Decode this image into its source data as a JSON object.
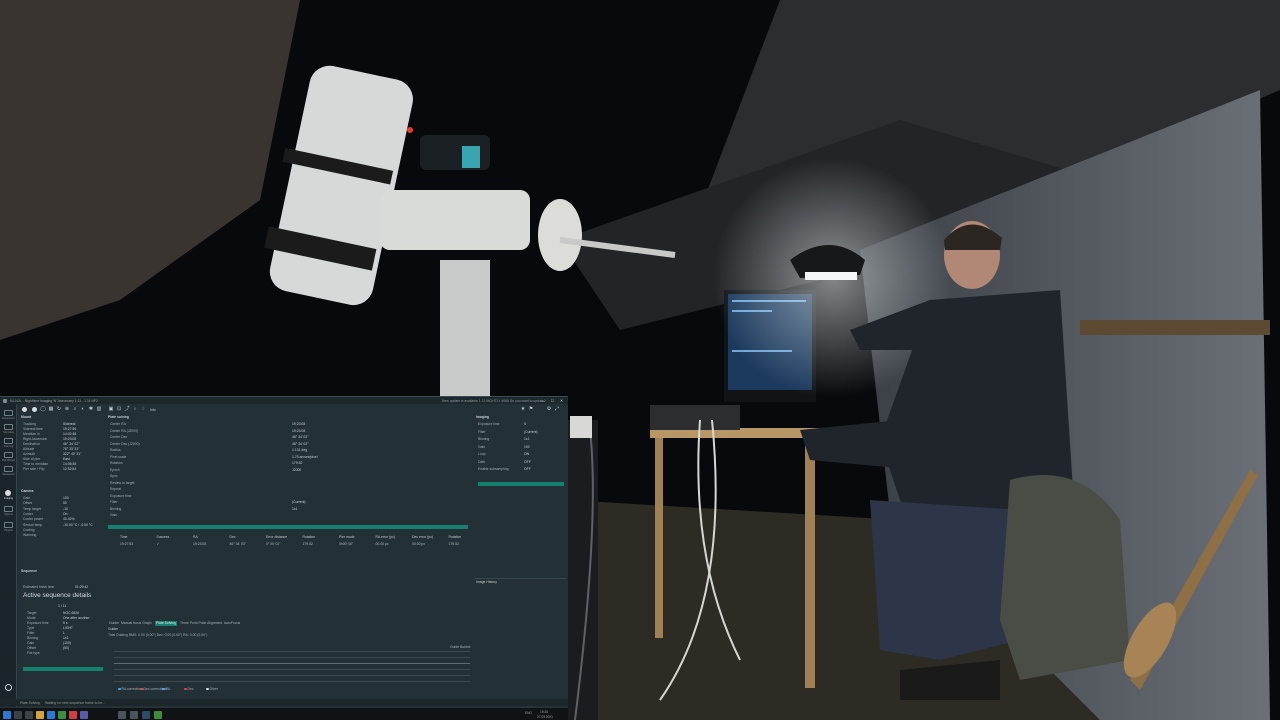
{
  "window": {
    "title": "N.I.N.A. - Nighttime Imaging 'N' Astronomy 1.11 - 1.11 HF2",
    "notice": "New update is available 1.11 NIGHTLY #065 Do you want to update?",
    "minimize": "—",
    "maximize": "☐",
    "close": "✕"
  },
  "sidebar": {
    "items": [
      {
        "label": "Equipment",
        "icon": "telescope-icon"
      },
      {
        "label": "Sky Atlas",
        "icon": "atlas-icon"
      },
      {
        "label": "Framing",
        "icon": "framing-icon"
      },
      {
        "label": "Flat Wizard",
        "icon": "flat-wizard-icon"
      },
      {
        "label": "Sequencer",
        "icon": "sequencer-icon"
      },
      {
        "label": "Imaging",
        "icon": "imaging-icon"
      },
      {
        "label": "Options",
        "icon": "gear-icon"
      },
      {
        "label": "Plugins",
        "icon": "puzzle-icon"
      }
    ]
  },
  "toolbar": {
    "info_label": "Info"
  },
  "mount_panel": {
    "title": "Mount",
    "rows": [
      {
        "k": "Tracking",
        "v": "Sidereal"
      },
      {
        "k": "Sidereal time",
        "v": "19:27:56"
      },
      {
        "k": "Meridian in",
        "v": "14:02:48"
      },
      {
        "k": "Right Ascension",
        "v": "19:23:08"
      },
      {
        "k": "Declination",
        "v": "46° 34' 02\""
      },
      {
        "k": "Altitude",
        "v": "76° 33' 31\""
      },
      {
        "k": "Azimuth",
        "v": "322° 40' 31\""
      },
      {
        "k": "Side of pier",
        "v": "East"
      },
      {
        "k": "Time to meridian",
        "v": "14:05:45"
      },
      {
        "k": "Pier side / Flip",
        "v": "12:52:54"
      }
    ]
  },
  "camera_panel": {
    "title": "Camera",
    "rows": [
      {
        "k": "Gain",
        "v": "100"
      },
      {
        "k": "Offset",
        "v": "50"
      },
      {
        "k": "Temp target",
        "v": "-10"
      },
      {
        "k": "Cooler",
        "v": "On"
      },
      {
        "k": "Cooler power",
        "v": "40.42%"
      },
      {
        "k": "Sensor temp",
        "v": "-10.00 °C / -0.00 °C"
      },
      {
        "k": "Cooling",
        "v": ""
      },
      {
        "k": "Warming",
        "v": ""
      }
    ]
  },
  "sequence_panel": {
    "title": "Sequence",
    "target_label": "Estimated finish time",
    "target_value": "01:29:42",
    "active_title": "Active sequence details",
    "counter": "1 / 11",
    "rows": [
      {
        "k": "Target",
        "v": "NGC 6826"
      },
      {
        "k": "Mode",
        "v": "One after another"
      },
      {
        "k": "Exposure time",
        "v": "5 s"
      },
      {
        "k": "Type",
        "v": "LIGHT"
      },
      {
        "k": "Filter",
        "v": "L"
      },
      {
        "k": "Binning",
        "v": "1x1"
      },
      {
        "k": "Gain",
        "v": "(100)"
      },
      {
        "k": "Offset",
        "v": "(50)"
      },
      {
        "k": "File type",
        "v": ""
      }
    ]
  },
  "image_history": {
    "title": "Plate solving",
    "rows": [
      {
        "k": "Center RA",
        "v": "19:23:08"
      },
      {
        "k": "Center RA (J2000)",
        "v": "19:23:08"
      },
      {
        "k": "Center Dec",
        "v": "46° 34' 02\""
      },
      {
        "k": "Center Dec (J2000)",
        "v": "46° 34' 02\""
      },
      {
        "k": "Radius",
        "v": "1.131 deg"
      },
      {
        "k": "Pixel scale",
        "v": "1.75 arcsec/pixel"
      },
      {
        "k": "Rotation",
        "v": "179.52"
      },
      {
        "k": "Epoch",
        "v": "J2000"
      },
      {
        "k": "Sync",
        "v": ""
      },
      {
        "k": "Reslew to target",
        "v": ""
      },
      {
        "k": "Repeat",
        "v": ""
      },
      {
        "k": "Exposure time",
        "v": ""
      },
      {
        "k": "Filter",
        "v": "(Current)"
      },
      {
        "k": "Binning",
        "v": "1x1"
      },
      {
        "k": "Gain",
        "v": ""
      }
    ],
    "columns": [
      "Time",
      "Success",
      "RA",
      "Dec",
      "Error distance",
      "Rotation",
      "Pier mode",
      "RA error (px)",
      "Dec error (px)",
      "Rotation"
    ],
    "cells": [
      "19:27:53",
      "✓",
      "19:23:08",
      "46° 34' 03\"",
      "0° 00' 02\"",
      "179.52",
      "0h00' 00\"",
      "00.00 px",
      "00.00 px",
      "179.52"
    ]
  },
  "imaging_panel": {
    "title": "Imaging",
    "rows": [
      {
        "k": "Exposure time",
        "v": "5"
      },
      {
        "k": "Filter",
        "v": "(Current)"
      },
      {
        "k": "Binning",
        "v": "1x1"
      },
      {
        "k": "Gain",
        "v": "100"
      },
      {
        "k": "Loop",
        "v": "ON"
      },
      {
        "k": "Dark",
        "v": "OFF"
      },
      {
        "k": "Enable subsampling",
        "v": "OFF"
      }
    ],
    "history_title": "Image History"
  },
  "tabs": [
    "Guider",
    "Manual focus Graph",
    "Plate Solving",
    "Three Point Polar Alignment",
    "AutoFocus"
  ],
  "guider": {
    "title": "Guider",
    "status": "Total Guiding RMS: 0.00 (0.00\") Dec: 0.00 (0.00\") RA: 0.00 (0.00\")",
    "scale": "Guide Bubble",
    "legend": [
      "RA corrections",
      "Dec corrections",
      "RA",
      "Dec",
      "Other"
    ]
  },
  "statusbar": {
    "left": "Plate Solving",
    "center": "Waiting for next sequence frame to be...",
    "right": ""
  },
  "taskbar": {
    "time": "19:28",
    "date": "27.09.2021",
    "lang": "ENG"
  }
}
